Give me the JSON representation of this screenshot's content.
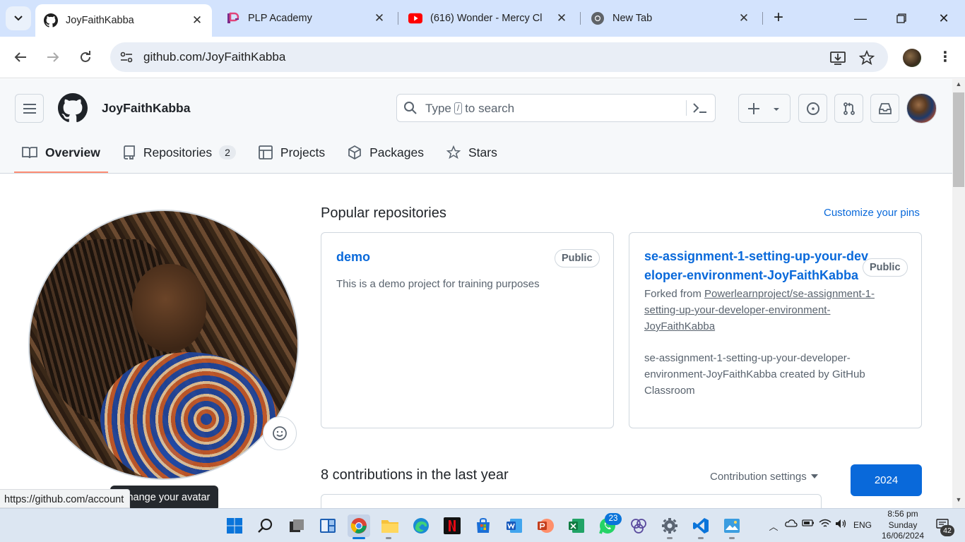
{
  "browser": {
    "tabs": [
      {
        "title": "JoyFaithKabba",
        "icon": "github-icon",
        "active": true
      },
      {
        "title": "PLP Academy",
        "icon": "plp-icon",
        "active": false
      },
      {
        "title": "(616) Wonder - Mercy Cl",
        "icon": "youtube-icon",
        "active": false
      },
      {
        "title": "New Tab",
        "icon": "chrome-icon",
        "active": false
      }
    ],
    "url": "github.com/JoyFaithKabba",
    "status_url": "https://github.com/account"
  },
  "github": {
    "username": "JoyFaithKabba",
    "search_placeholder_pre": "Type",
    "search_key": "/",
    "search_placeholder_post": "to search",
    "nav": [
      {
        "label": "Overview",
        "icon": "book-icon",
        "selected": true
      },
      {
        "label": "Repositories",
        "icon": "repo-icon",
        "count": "2"
      },
      {
        "label": "Projects",
        "icon": "table-icon"
      },
      {
        "label": "Packages",
        "icon": "package-icon"
      },
      {
        "label": "Stars",
        "icon": "star-icon"
      }
    ],
    "avatar_tooltip": "Change your avatar",
    "popular_title": "Popular repositories",
    "customize_pins": "Customize your pins",
    "repos": [
      {
        "name": "demo",
        "visibility": "Public",
        "description": "This is a demo project for training purposes"
      },
      {
        "name_line1": "se-assignment-1-setting-up-your-dev",
        "name_line2": "eloper-environment-JoyFaithKabba",
        "visibility": "Public",
        "forked_prefix": "Forked from",
        "forked_line1": "Powerlearnproject/se-assignment-1-",
        "forked_line2": "setting-up-your-developer-environment-",
        "forked_line3": "JoyFaithKabba",
        "desc_line1": "se-assignment-1-setting-up-your-developer-",
        "desc_line2": "environment-JoyFaithKabba created by GitHub",
        "desc_line3": "Classroom"
      }
    ],
    "contributions_title": "8 contributions in the last year",
    "contribution_settings": "Contribution settings",
    "year": "2024"
  },
  "taskbar": {
    "whatsapp_badge": "23",
    "language": "ENG",
    "time": "8:56 pm",
    "day": "Sunday",
    "date": "16/06/2024",
    "notifications": "42"
  },
  "colors": {
    "accent": "#0969da",
    "nav_underline": "#fd8c73",
    "tab_strip": "#d3e3fd"
  }
}
